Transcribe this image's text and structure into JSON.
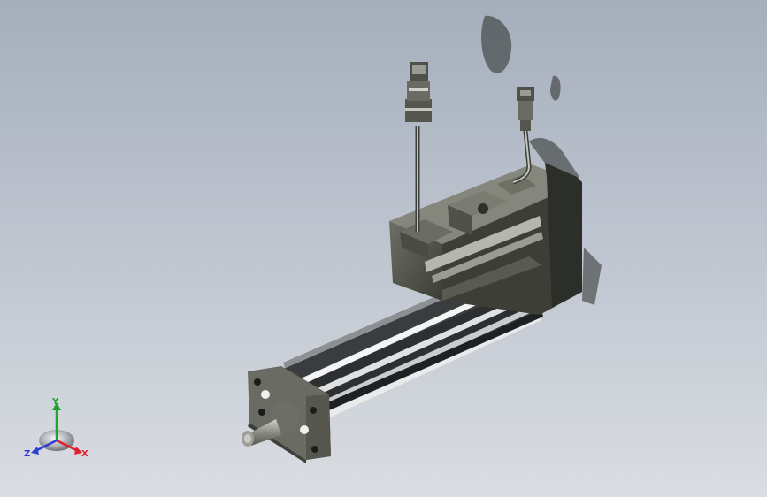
{
  "viewport": {
    "background_top": "#a5aebc",
    "background_bottom": "#dadde2"
  },
  "model": {
    "body_color": "#4a4c43",
    "rail_color": "#d9dcdf"
  },
  "triad": {
    "x_label": "X",
    "y_label": "Y",
    "z_label": "Z",
    "x_color": "#e0202a",
    "y_color": "#1fa52c",
    "z_color": "#2b3fd6"
  }
}
